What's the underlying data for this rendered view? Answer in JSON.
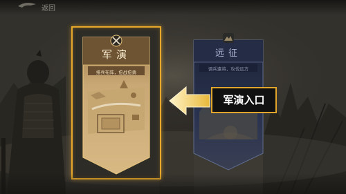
{
  "topbar": {
    "title": "返回"
  },
  "cards": {
    "drill": {
      "title": "军演",
      "subtitle": "排兵布阵，愈战愈勇",
      "badge_icon": "crossed-swords-icon",
      "selected": true
    },
    "expedition": {
      "title": "远征",
      "subtitle": "调兵遣将，攻伐远方",
      "badge_icon": "mountain-emblem-icon",
      "selected": false
    }
  },
  "hint": {
    "label": "军演入口",
    "arrow_icon": "arrow-left-icon"
  },
  "colors": {
    "highlight": "#e8a92a",
    "drill_banner": "#8a6a3d",
    "expedition_banner": "#232c45"
  }
}
